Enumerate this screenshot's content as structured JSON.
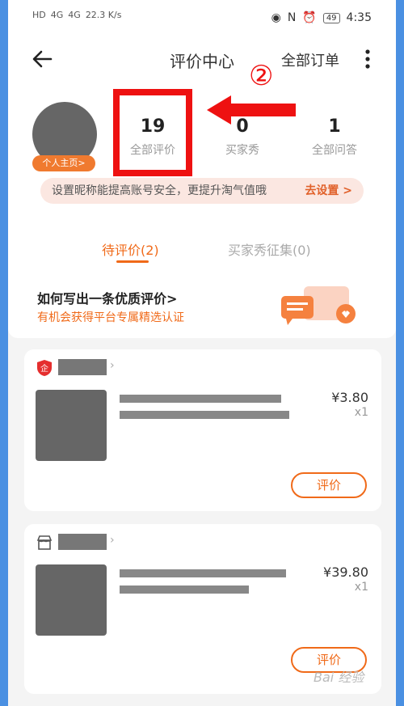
{
  "status_bar": {
    "left_labels": [
      "HD",
      "4G",
      "4G",
      "22.3 K/s"
    ],
    "time": "4:35",
    "battery": "49"
  },
  "navbar": {
    "title": "评价中心",
    "all_orders": "全部订单"
  },
  "profile": {
    "badge": "个人主页>",
    "stats": [
      {
        "value": "19",
        "label": "全部评价"
      },
      {
        "value": "0",
        "label": "买家秀"
      },
      {
        "value": "1",
        "label": "全部问答"
      }
    ],
    "annotation": "②"
  },
  "tip": {
    "text": "设置昵称能提高账号安全，更提升淘气值哦",
    "link": "去设置 >"
  },
  "tabs": [
    {
      "label": "待评价(2)",
      "active": true
    },
    {
      "label": "买家秀征集(0)",
      "active": false
    }
  ],
  "guide": {
    "title": "如何写出一条优质评价>",
    "subtitle": "有机会获得平台专属精选认证"
  },
  "orders": [
    {
      "price": "¥3.80",
      "qty": "x1",
      "button": "评价",
      "shop_icon": "enterprise-shop-icon"
    },
    {
      "price": "¥39.80",
      "qty": "x1",
      "button": "评价",
      "shop_icon": "store-icon"
    }
  ],
  "watermark": "Bai 经验",
  "colors": {
    "accent": "#f06a19",
    "highlight": "#ee1111",
    "frame": "#4a90e2"
  }
}
